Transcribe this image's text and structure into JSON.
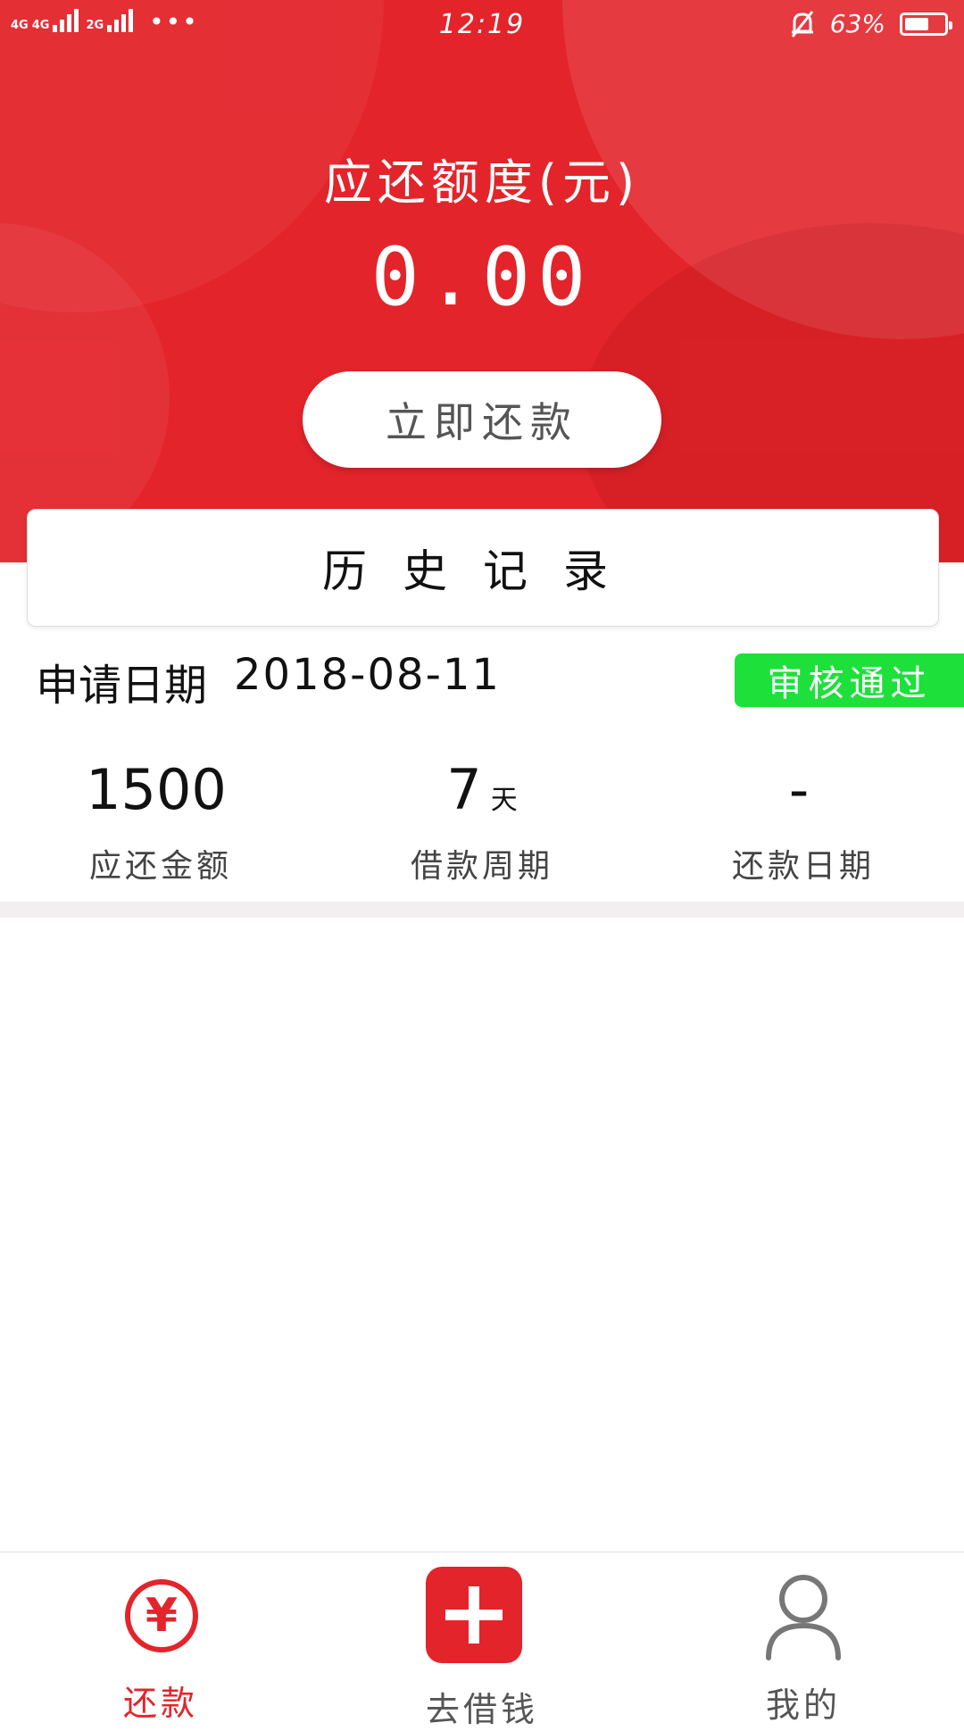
{
  "status_bar": {
    "signal_labels": [
      "4G",
      "4G",
      "2G"
    ],
    "time": "12:19",
    "battery_percent": "63%",
    "battery_level": 0.63,
    "icons": [
      "signal-icon",
      "more-dots-icon",
      "bell-muted-icon",
      "battery-icon"
    ]
  },
  "hero": {
    "title": "应还额度(元)",
    "amount": "0.00",
    "repay_button": "立即还款",
    "accent_color": "#e3242b"
  },
  "history": {
    "title": "历史记录"
  },
  "record": {
    "apply_label": "申请日期",
    "apply_date": "2018-08-11",
    "status": "审核通过",
    "status_color": "#1ee03b",
    "stats": [
      {
        "value": "1500",
        "unit": "",
        "label": "应还金额"
      },
      {
        "value": "7",
        "unit": "天",
        "label": "借款周期"
      },
      {
        "value": "-",
        "unit": "",
        "label": "还款日期"
      }
    ]
  },
  "bottom_nav": {
    "items": [
      {
        "label": "还款",
        "icon": "yen-circle-icon",
        "active": true
      },
      {
        "label": "去借钱",
        "icon": "plus-icon",
        "active": false
      },
      {
        "label": "我的",
        "icon": "person-icon",
        "active": false
      }
    ]
  }
}
